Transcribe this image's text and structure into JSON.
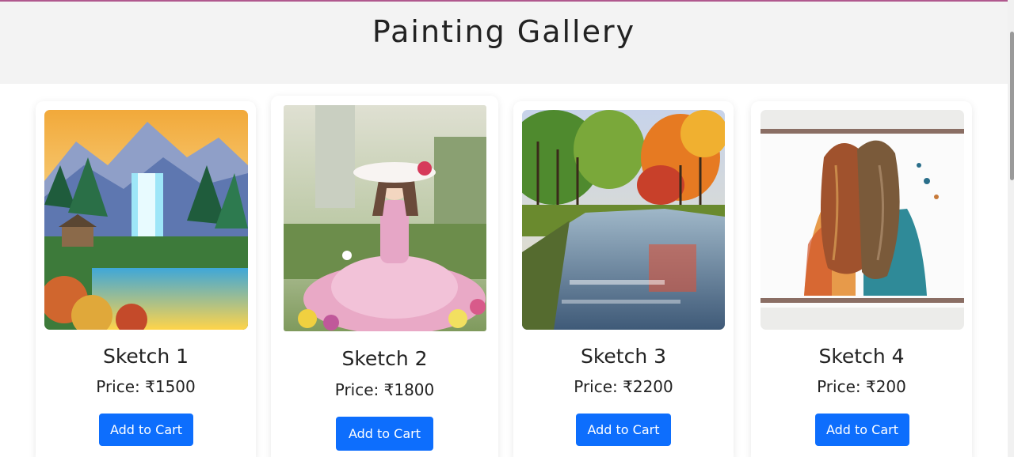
{
  "page": {
    "title": "Painting Gallery"
  },
  "cards": [
    {
      "title": "Sketch 1",
      "price": "Price: ₹1500",
      "button": "Add to Cart",
      "image_icon": "waterfall-landscape-painting"
    },
    {
      "title": "Sketch 2",
      "price": "Price: ₹1800",
      "button": "Add to Cart",
      "image_icon": "girl-in-pink-dress-painting"
    },
    {
      "title": "Sketch 3",
      "price": "Price: ₹2200",
      "button": "Add to Cart",
      "image_icon": "autumn-river-painting"
    },
    {
      "title": "Sketch 4",
      "price": "Price: ₹200",
      "button": "Add to Cart",
      "image_icon": "two-girls-watercolor-painting"
    }
  ],
  "colors": {
    "accent": "#0d6efd",
    "header_bg": "#f3f3f3",
    "top_border": "#b0588e"
  }
}
